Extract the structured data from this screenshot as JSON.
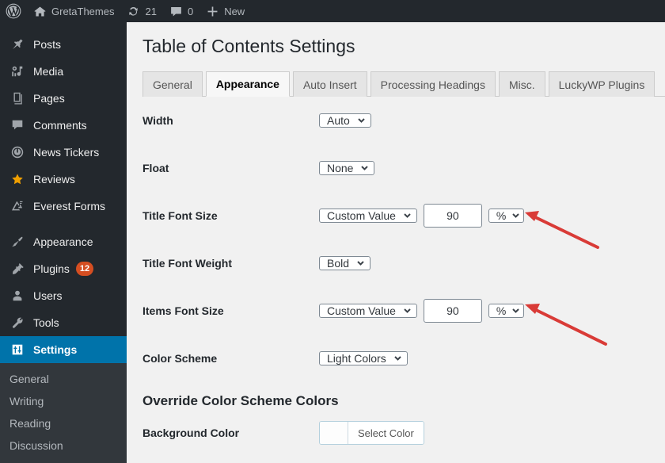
{
  "adminbar": {
    "logo_icon": "wordpress-logo-icon",
    "site_icon": "home-icon",
    "site_name": "GretaThemes",
    "updates_icon": "updates-icon",
    "updates_count": "21",
    "comments_icon": "comment-bubble-icon",
    "comments_count": "0",
    "new_icon": "plus-icon",
    "new_label": "New"
  },
  "sidebar": {
    "items": [
      {
        "label": "Posts",
        "icon": "pin-icon"
      },
      {
        "label": "Media",
        "icon": "media-icon"
      },
      {
        "label": "Pages",
        "icon": "pages-icon"
      },
      {
        "label": "Comments",
        "icon": "comment-bubble-icon"
      },
      {
        "label": "News Tickers",
        "icon": "news-ticker-icon"
      },
      {
        "label": "Reviews",
        "icon": "star-icon"
      },
      {
        "label": "Everest Forms",
        "icon": "everest-forms-icon"
      },
      {
        "label": "Appearance",
        "icon": "paintbrush-icon"
      },
      {
        "label": "Plugins",
        "icon": "plugin-icon",
        "badge": "12"
      },
      {
        "label": "Users",
        "icon": "user-icon"
      },
      {
        "label": "Tools",
        "icon": "wrench-icon"
      },
      {
        "label": "Settings",
        "icon": "settings-sliders-icon",
        "current": true
      }
    ],
    "submenu": [
      {
        "label": "General"
      },
      {
        "label": "Writing"
      },
      {
        "label": "Reading"
      },
      {
        "label": "Discussion"
      }
    ],
    "active_color": "#0073aa",
    "badge_color": "#d54e21"
  },
  "page": {
    "title": "Table of Contents Settings"
  },
  "tabs": [
    {
      "label": "General",
      "active": false
    },
    {
      "label": "Appearance",
      "active": true
    },
    {
      "label": "Auto Insert",
      "active": false
    },
    {
      "label": "Processing Headings",
      "active": false
    },
    {
      "label": "Misc.",
      "active": false
    },
    {
      "label": "LuckyWP Plugins",
      "active": false
    }
  ],
  "settings": {
    "width": {
      "label": "Width",
      "value": "Auto"
    },
    "float": {
      "label": "Float",
      "value": "None"
    },
    "title_font_size": {
      "label": "Title Font Size",
      "mode": "Custom Value",
      "value": "90",
      "unit": "%"
    },
    "title_font_weight": {
      "label": "Title Font Weight",
      "value": "Bold"
    },
    "items_font_size": {
      "label": "Items Font Size",
      "mode": "Custom Value",
      "value": "90",
      "unit": "%"
    },
    "color_scheme": {
      "label": "Color Scheme",
      "value": "Light Colors"
    },
    "override_section_title": "Override Color Scheme Colors",
    "background_color": {
      "label": "Background Color",
      "button_label": "Select Color"
    }
  },
  "annotations": {
    "arrow_color": "#d93b37",
    "arrows": [
      {
        "name": "arrow-to-title-font-unit",
        "target": "title-font-size-unit-select"
      },
      {
        "name": "arrow-to-items-font-unit",
        "target": "items-font-size-unit-select"
      }
    ]
  }
}
